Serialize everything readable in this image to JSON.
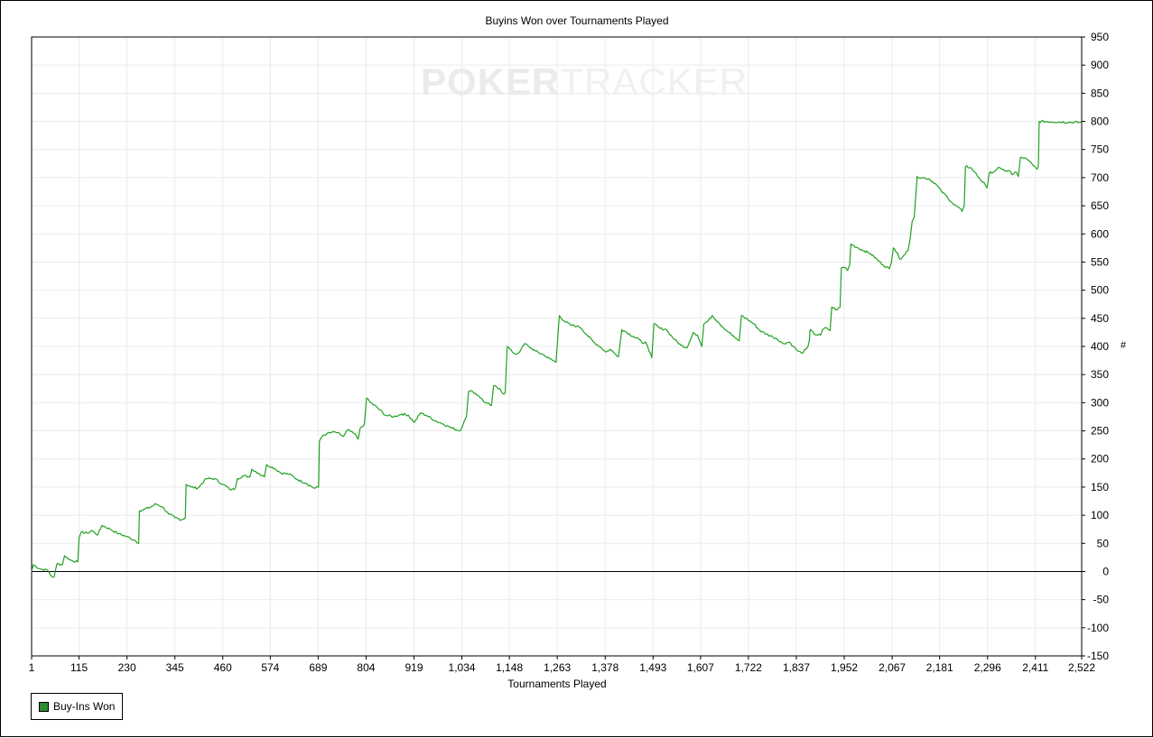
{
  "chart_data": {
    "type": "line",
    "title": "Buyins Won over Tournaments Played",
    "xlabel": "Tournaments Played",
    "ylabel": "#",
    "watermark": {
      "part1": "PO",
      "part2": "KER",
      "part3": "TRACKER"
    },
    "xlim": [
      1,
      2522
    ],
    "ylim": [
      -150,
      950
    ],
    "xticks": [
      "1",
      "115",
      "230",
      "345",
      "460",
      "574",
      "689",
      "804",
      "919",
      "1,034",
      "1,148",
      "1,263",
      "1,378",
      "1,493",
      "1,607",
      "1,722",
      "1,837",
      "1,952",
      "2,067",
      "2,181",
      "2,296",
      "2,411",
      "2,522"
    ],
    "yticks": [
      950,
      900,
      850,
      800,
      750,
      700,
      650,
      600,
      550,
      500,
      450,
      400,
      350,
      300,
      250,
      200,
      150,
      100,
      50,
      0,
      -50,
      -100,
      -150
    ],
    "grid": true,
    "legend_position": "bottom-left",
    "colors": {
      "line": "#22a122",
      "swatch": "#2e8b2e",
      "grid": "#ebebeb",
      "zero_line": "#000000"
    },
    "series": [
      {
        "name": "Buy-Ins Won",
        "points": [
          [
            1,
            0
          ],
          [
            5,
            12
          ],
          [
            20,
            5
          ],
          [
            40,
            2
          ],
          [
            48,
            -8
          ],
          [
            55,
            -10
          ],
          [
            62,
            14
          ],
          [
            75,
            12
          ],
          [
            80,
            28
          ],
          [
            95,
            20
          ],
          [
            112,
            17
          ],
          [
            115,
            60
          ],
          [
            120,
            70
          ],
          [
            135,
            68
          ],
          [
            145,
            73
          ],
          [
            160,
            65
          ],
          [
            170,
            82
          ],
          [
            190,
            75
          ],
          [
            210,
            67
          ],
          [
            230,
            62
          ],
          [
            250,
            55
          ],
          [
            258,
            50
          ],
          [
            260,
            108
          ],
          [
            270,
            110
          ],
          [
            285,
            114
          ],
          [
            300,
            120
          ],
          [
            315,
            115
          ],
          [
            330,
            102
          ],
          [
            345,
            96
          ],
          [
            360,
            92
          ],
          [
            370,
            95
          ],
          [
            372,
            155
          ],
          [
            385,
            150
          ],
          [
            400,
            148
          ],
          [
            420,
            165
          ],
          [
            440,
            165
          ],
          [
            460,
            155
          ],
          [
            480,
            145
          ],
          [
            490,
            148
          ],
          [
            495,
            165
          ],
          [
            510,
            170
          ],
          [
            525,
            168
          ],
          [
            530,
            182
          ],
          [
            545,
            175
          ],
          [
            560,
            168
          ],
          [
            565,
            190
          ],
          [
            585,
            183
          ],
          [
            600,
            175
          ],
          [
            620,
            173
          ],
          [
            640,
            163
          ],
          [
            660,
            157
          ],
          [
            680,
            148
          ],
          [
            690,
            150
          ],
          [
            692,
            232
          ],
          [
            700,
            242
          ],
          [
            710,
            245
          ],
          [
            730,
            248
          ],
          [
            750,
            240
          ],
          [
            760,
            252
          ],
          [
            780,
            242
          ],
          [
            785,
            235
          ],
          [
            790,
            255
          ],
          [
            800,
            262
          ],
          [
            805,
            308
          ],
          [
            815,
            300
          ],
          [
            830,
            292
          ],
          [
            850,
            278
          ],
          [
            870,
            275
          ],
          [
            890,
            280
          ],
          [
            905,
            278
          ],
          [
            920,
            265
          ],
          [
            935,
            282
          ],
          [
            950,
            277
          ],
          [
            970,
            268
          ],
          [
            990,
            262
          ],
          [
            1010,
            255
          ],
          [
            1030,
            250
          ],
          [
            1040,
            268
          ],
          [
            1045,
            275
          ],
          [
            1050,
            320
          ],
          [
            1060,
            320
          ],
          [
            1075,
            312
          ],
          [
            1090,
            300
          ],
          [
            1105,
            295
          ],
          [
            1110,
            330
          ],
          [
            1125,
            325
          ],
          [
            1135,
            315
          ],
          [
            1138,
            318
          ],
          [
            1143,
            400
          ],
          [
            1155,
            390
          ],
          [
            1165,
            386
          ],
          [
            1175,
            393
          ],
          [
            1185,
            405
          ],
          [
            1195,
            400
          ],
          [
            1210,
            392
          ],
          [
            1230,
            385
          ],
          [
            1245,
            378
          ],
          [
            1260,
            372
          ],
          [
            1268,
            455
          ],
          [
            1280,
            445
          ],
          [
            1295,
            438
          ],
          [
            1310,
            436
          ],
          [
            1320,
            433
          ],
          [
            1335,
            420
          ],
          [
            1350,
            408
          ],
          [
            1365,
            400
          ],
          [
            1380,
            390
          ],
          [
            1390,
            395
          ],
          [
            1400,
            388
          ],
          [
            1410,
            382
          ],
          [
            1418,
            430
          ],
          [
            1430,
            425
          ],
          [
            1445,
            418
          ],
          [
            1460,
            412
          ],
          [
            1470,
            405
          ],
          [
            1475,
            408
          ],
          [
            1480,
            400
          ],
          [
            1490,
            380
          ],
          [
            1495,
            440
          ],
          [
            1510,
            432
          ],
          [
            1525,
            430
          ],
          [
            1530,
            425
          ],
          [
            1545,
            412
          ],
          [
            1560,
            402
          ],
          [
            1575,
            398
          ],
          [
            1590,
            425
          ],
          [
            1600,
            420
          ],
          [
            1610,
            400
          ],
          [
            1615,
            440
          ],
          [
            1625,
            445
          ],
          [
            1635,
            455
          ],
          [
            1650,
            443
          ],
          [
            1660,
            435
          ],
          [
            1675,
            425
          ],
          [
            1690,
            415
          ],
          [
            1700,
            410
          ],
          [
            1705,
            455
          ],
          [
            1720,
            448
          ],
          [
            1735,
            440
          ],
          [
            1750,
            428
          ],
          [
            1765,
            422
          ],
          [
            1780,
            417
          ],
          [
            1790,
            414
          ],
          [
            1805,
            405
          ],
          [
            1820,
            408
          ],
          [
            1830,
            400
          ],
          [
            1840,
            392
          ],
          [
            1850,
            388
          ],
          [
            1860,
            395
          ],
          [
            1865,
            400
          ],
          [
            1868,
            410
          ],
          [
            1870,
            430
          ],
          [
            1880,
            422
          ],
          [
            1895,
            420
          ],
          [
            1900,
            430
          ],
          [
            1910,
            433
          ],
          [
            1918,
            428
          ],
          [
            1922,
            470
          ],
          [
            1935,
            465
          ],
          [
            1942,
            470
          ],
          [
            1945,
            540
          ],
          [
            1955,
            540
          ],
          [
            1960,
            535
          ],
          [
            1965,
            545
          ],
          [
            1968,
            582
          ],
          [
            1985,
            575
          ],
          [
            2000,
            570
          ],
          [
            2015,
            565
          ],
          [
            2030,
            555
          ],
          [
            2045,
            545
          ],
          [
            2060,
            538
          ],
          [
            2065,
            548
          ],
          [
            2070,
            575
          ],
          [
            2080,
            566
          ],
          [
            2085,
            555
          ],
          [
            2095,
            562
          ],
          [
            2105,
            570
          ],
          [
            2110,
            590
          ],
          [
            2115,
            622
          ],
          [
            2120,
            630
          ],
          [
            2127,
            702
          ],
          [
            2140,
            700
          ],
          [
            2155,
            698
          ],
          [
            2170,
            690
          ],
          [
            2185,
            676
          ],
          [
            2200,
            665
          ],
          [
            2215,
            652
          ],
          [
            2225,
            648
          ],
          [
            2235,
            640
          ],
          [
            2240,
            650
          ],
          [
            2243,
            720
          ],
          [
            2255,
            718
          ],
          [
            2265,
            710
          ],
          [
            2275,
            700
          ],
          [
            2290,
            688
          ],
          [
            2295,
            682
          ],
          [
            2300,
            708
          ],
          [
            2315,
            712
          ],
          [
            2325,
            718
          ],
          [
            2330,
            715
          ],
          [
            2340,
            712
          ],
          [
            2350,
            712
          ],
          [
            2355,
            705
          ],
          [
            2365,
            710
          ],
          [
            2370,
            702
          ],
          [
            2375,
            736
          ],
          [
            2385,
            735
          ],
          [
            2395,
            730
          ],
          [
            2405,
            722
          ],
          [
            2415,
            715
          ],
          [
            2418,
            720
          ],
          [
            2420,
            800
          ],
          [
            2522,
            798
          ]
        ]
      }
    ]
  }
}
